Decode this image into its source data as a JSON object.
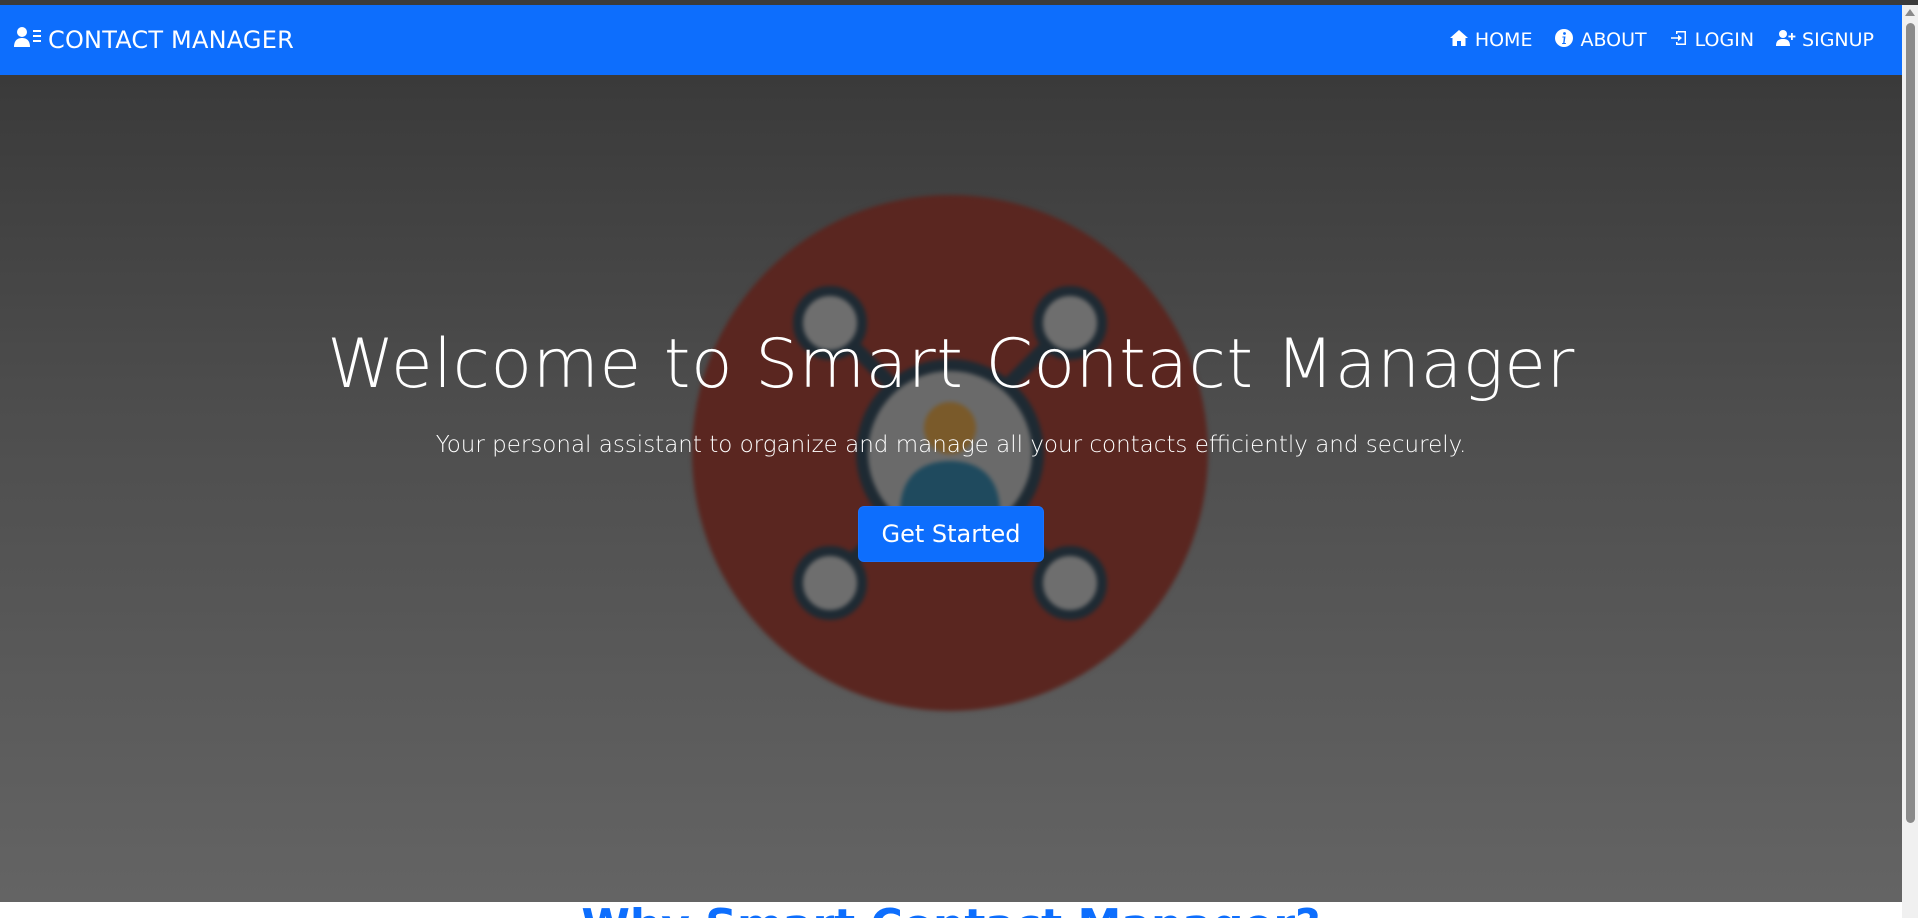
{
  "navbar": {
    "brand_label": "CONTACT MANAGER",
    "brand_icon": "user-list-icon",
    "links": [
      {
        "label": "HOME",
        "icon": "home-icon"
      },
      {
        "label": "ABOUT",
        "icon": "info-icon"
      },
      {
        "label": "LOGIN",
        "icon": "login-icon"
      },
      {
        "label": "SIGNUP",
        "icon": "user-plus-icon"
      }
    ],
    "background_color": "#0d6efd"
  },
  "hero": {
    "title": "Welcome to Smart Contact Manager",
    "subtitle": "Your personal assistant to organize and manage all your contacts efficiently and securely.",
    "cta_label": "Get Started",
    "illustration_icon": "contact-network-icon"
  },
  "next_section": {
    "heading_partial": "Why Smart Contact Manager?"
  },
  "colors": {
    "accent": "#0d6efd",
    "illustration_circle": "#7a2a20"
  }
}
